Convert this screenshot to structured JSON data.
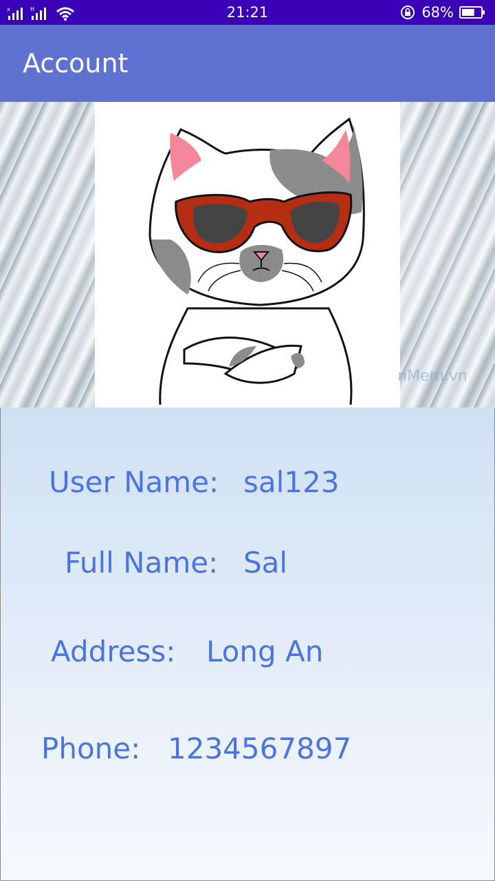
{
  "status_bar": {
    "time": "21:21",
    "battery_percent": "68%",
    "battery_level": 0.68,
    "icons": [
      "signal-icon-sim1",
      "signal-icon-sim2",
      "wifi-icon",
      "rotation-lock-icon",
      "battery-icon"
    ]
  },
  "app_bar": {
    "title": "Account"
  },
  "header": {
    "avatar": "cat-with-sunglasses",
    "watermark": "nMem.vn"
  },
  "profile": {
    "user_name_label": "User Name:",
    "user_name_value": "sal123",
    "full_name_label": "Full Name:",
    "full_name_value": "Sal",
    "address_label": "Address:",
    "address_value": "Long An",
    "phone_label": "Phone:",
    "phone_value": "1234567897"
  },
  "colors": {
    "status_bar": "#3a00b5",
    "app_bar": "#5f71d1",
    "text_accent": "#4a74e0",
    "panel_top": "#cfe0f4",
    "panel_bottom": "#f7f9fc"
  }
}
